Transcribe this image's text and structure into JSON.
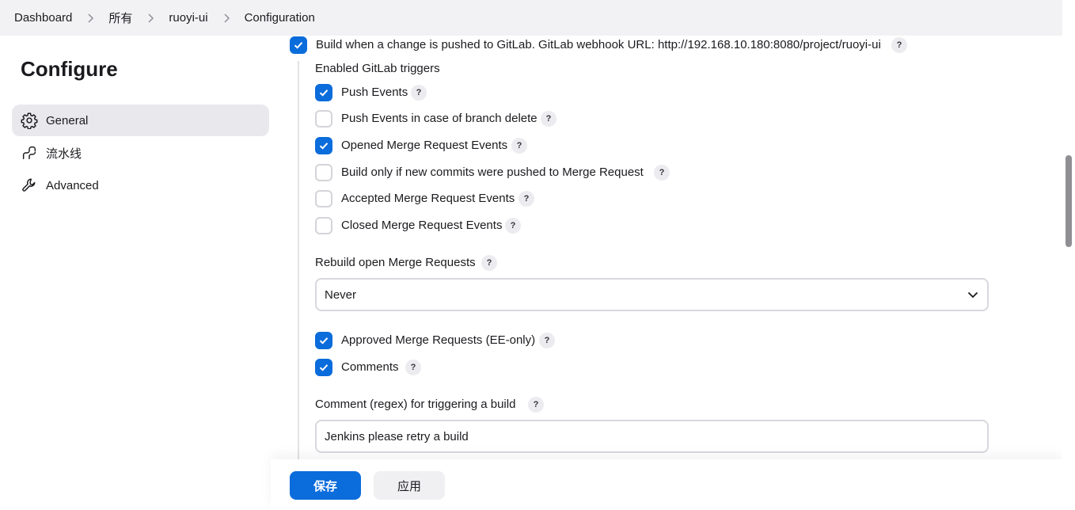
{
  "breadcrumb": [
    "Dashboard",
    "所有",
    "ruoyi-ui",
    "Configuration"
  ],
  "page_title": "Configure",
  "sidebar": {
    "items": [
      {
        "label": "General",
        "icon": "gear-icon",
        "active": true
      },
      {
        "label": "流水线",
        "icon": "pipeline-icon",
        "active": false
      },
      {
        "label": "Advanced",
        "icon": "wrench-icon",
        "active": false
      }
    ]
  },
  "build_trigger": {
    "label": "Build when a change is pushed to GitLab. GitLab webhook URL: http://192.168.10.180:8080/project/ruoyi-ui",
    "checked": true
  },
  "triggers_heading": "Enabled GitLab triggers",
  "triggers": [
    {
      "label": "Push Events",
      "checked": true
    },
    {
      "label": "Push Events in case of branch delete",
      "checked": false
    },
    {
      "label": "Opened Merge Request Events",
      "checked": true
    },
    {
      "label": "Build only if new commits were pushed to Merge Request",
      "checked": false
    },
    {
      "label": "Accepted Merge Request Events",
      "checked": false
    },
    {
      "label": "Closed Merge Request Events",
      "checked": false
    }
  ],
  "rebuild": {
    "label": "Rebuild open Merge Requests",
    "value": "Never"
  },
  "extra_triggers": [
    {
      "label": "Approved Merge Requests (EE-only)",
      "checked": true
    },
    {
      "label": "Comments",
      "checked": true
    }
  ],
  "comment_regex": {
    "label": "Comment (regex) for triggering a build",
    "value": "Jenkins please retry a build"
  },
  "help_mark": "?",
  "actions": {
    "save": "保存",
    "apply": "应用"
  },
  "colors": {
    "accent": "#0b6cdb",
    "topbar": "#f2f2f4",
    "sidebar_active": "#e9e9ed"
  }
}
